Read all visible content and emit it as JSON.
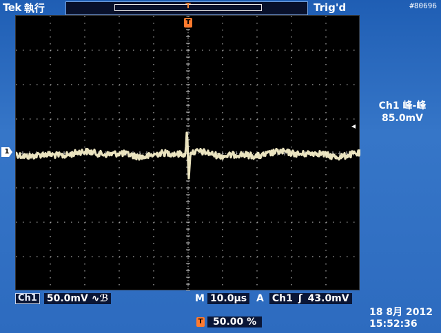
{
  "header": {
    "brand": "Tek",
    "run_status": "執行",
    "trigger_state": "Trig'd",
    "label": "#80696"
  },
  "record": {
    "trigger_marker": "T"
  },
  "channel": {
    "marker": "1",
    "name": "Ch1",
    "scale": "50.0mV",
    "bw_symbol": "∿ℬ"
  },
  "measurement": {
    "title": "Ch1 峰-峰",
    "value": "85.0mV"
  },
  "horizontal": {
    "prefix": "M",
    "scale": "10.0µs"
  },
  "trigger": {
    "prefix": "A",
    "source": "Ch1",
    "slope_symbol": "ʃ",
    "level": "43.0mV"
  },
  "position": {
    "icon": "T",
    "value": "50.00 %"
  },
  "datetime": {
    "date": "18 8月  2012",
    "time": "15:52:36"
  },
  "colors": {
    "trace": "#f5eec8",
    "grid": "#c8c8c8",
    "frame_blue": "#2a64b8",
    "trigger_orange": "#ff7a2e"
  }
}
